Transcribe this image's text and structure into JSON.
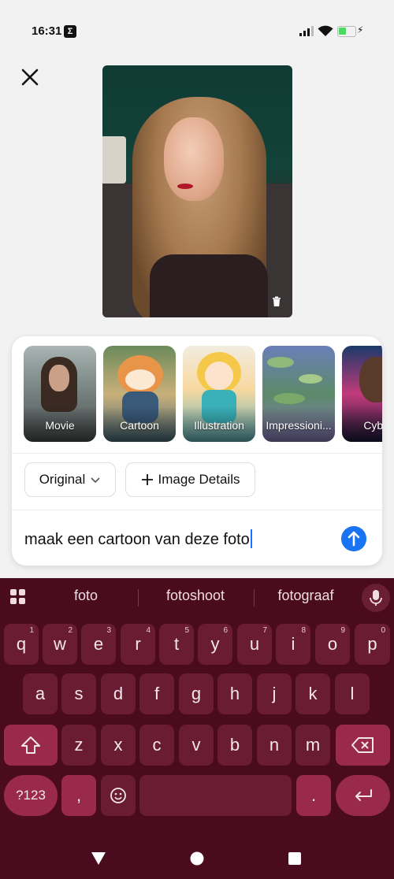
{
  "status_bar": {
    "time": "16:31",
    "notification_icon": "sigma-icon"
  },
  "styles": [
    {
      "label": "Movie"
    },
    {
      "label": "Cartoon"
    },
    {
      "label": "Illustration"
    },
    {
      "label": "Impressioni..."
    },
    {
      "label": "Cyber"
    }
  ],
  "controls": {
    "original": "Original",
    "image_details": "Image Details"
  },
  "prompt": {
    "value": "maak een cartoon van deze foto"
  },
  "keyboard": {
    "suggestions": [
      "foto",
      "fotoshoot",
      "fotograaf"
    ],
    "row1": [
      {
        "k": "q",
        "h": "1"
      },
      {
        "k": "w",
        "h": "2"
      },
      {
        "k": "e",
        "h": "3"
      },
      {
        "k": "r",
        "h": "4"
      },
      {
        "k": "t",
        "h": "5"
      },
      {
        "k": "y",
        "h": "6"
      },
      {
        "k": "u",
        "h": "7"
      },
      {
        "k": "i",
        "h": "8"
      },
      {
        "k": "o",
        "h": "9"
      },
      {
        "k": "p",
        "h": "0"
      }
    ],
    "row2": [
      "a",
      "s",
      "d",
      "f",
      "g",
      "h",
      "j",
      "k",
      "l"
    ],
    "row3": [
      "z",
      "x",
      "c",
      "v",
      "b",
      "n",
      "m"
    ],
    "numbers": "?123",
    "comma": ",",
    "period": "."
  },
  "colors": {
    "accent": "#1a73f0",
    "keyboard_bg": "#4a0b1f",
    "key": "#6b1c35"
  }
}
